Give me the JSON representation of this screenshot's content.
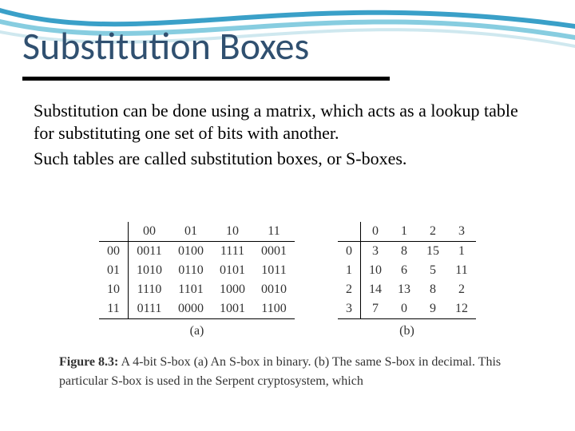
{
  "title": "Substitution Boxes",
  "body": {
    "p1": "Substitution can be done using a matrix, which acts as a lookup table for substituting one set of bits with another.",
    "p2": "Such tables are called substitution boxes, or S-boxes."
  },
  "chart_data": [
    {
      "type": "table",
      "label": "(a)",
      "col_headers": [
        "00",
        "01",
        "10",
        "11"
      ],
      "row_headers": [
        "00",
        "01",
        "10",
        "11"
      ],
      "rows": [
        [
          "0011",
          "0100",
          "1111",
          "0001"
        ],
        [
          "1010",
          "0110",
          "0101",
          "1011"
        ],
        [
          "1110",
          "1101",
          "1000",
          "0010"
        ],
        [
          "0111",
          "0000",
          "1001",
          "1100"
        ]
      ]
    },
    {
      "type": "table",
      "label": "(b)",
      "col_headers": [
        "0",
        "1",
        "2",
        "3"
      ],
      "row_headers": [
        "0",
        "1",
        "2",
        "3"
      ],
      "rows": [
        [
          "3",
          "8",
          "15",
          "1"
        ],
        [
          "10",
          "6",
          "5",
          "11"
        ],
        [
          "14",
          "13",
          "8",
          "2"
        ],
        [
          "7",
          "0",
          "9",
          "12"
        ]
      ]
    }
  ],
  "caption": {
    "figlabel": "Figure 8.3:",
    "text": " A 4-bit S-box (a) An S-box in binary.  (b) The same S-box in decimal.  This particular S-box is used in the Serpent cryptosystem, which"
  }
}
